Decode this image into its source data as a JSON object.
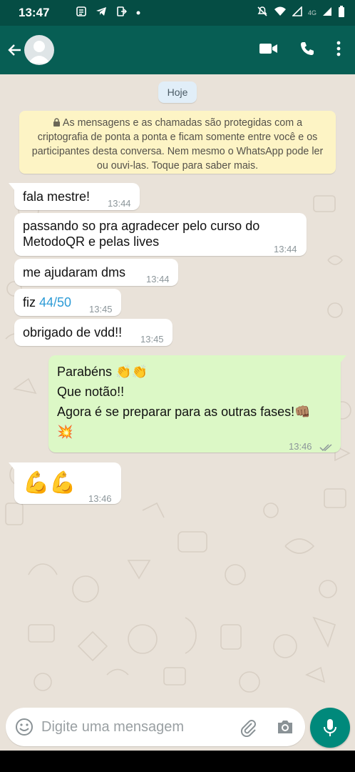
{
  "status_bar": {
    "time": "13:47",
    "network_label": "4G",
    "icons": [
      "gallery-icon",
      "telegram-icon",
      "exit-icon",
      "dot-icon",
      "mute-icon",
      "wifi-icon",
      "signal-icon",
      "signal-icon",
      "battery-icon"
    ]
  },
  "header": {
    "contact_name": "",
    "icons": [
      "back-arrow-icon",
      "avatar-icon",
      "video-call-icon",
      "phone-icon",
      "more-vert-icon"
    ]
  },
  "chat": {
    "date_chip": "Hoje",
    "encryption_notice": "As mensagens e as chamadas são protegidas com a criptografia de ponta a ponta e ficam somente entre você e os participantes desta conversa. Nem mesmo o WhatsApp pode ler ou ouvi-las. Toque para saber mais.",
    "messages": [
      {
        "direction": "in",
        "text": "fala mestre!",
        "time": "13:44"
      },
      {
        "direction": "in",
        "text_line1": "passando so pra agradecer pelo curso do",
        "text_line2": "MetodoQR e pelas lives",
        "time": "13:44"
      },
      {
        "direction": "in",
        "text": "me ajudaram dms",
        "time": "13:44"
      },
      {
        "direction": "in",
        "text_prefix": "fiz ",
        "text_link": "44/50",
        "time": "13:45"
      },
      {
        "direction": "in",
        "text": "obrigado de vdd!!",
        "time": "13:45"
      },
      {
        "direction": "out",
        "line1": "Parabéns 👏👏",
        "line2": "Que notão!!",
        "line3": "Agora é se preparar para as outras fases!👊🏽",
        "line4": "💥",
        "time": "13:46",
        "status": "read"
      },
      {
        "direction": "in",
        "text": "💪💪",
        "time": "13:46"
      }
    ]
  },
  "input_bar": {
    "placeholder": "Digite uma mensagem",
    "icons": [
      "emoji-icon",
      "attach-icon",
      "camera-icon",
      "mic-icon"
    ]
  },
  "colors": {
    "header": "#075e54",
    "status_bar": "#054d44",
    "chat_bg": "#e9e2d9",
    "outgoing_bubble": "#dcf8c6",
    "incoming_bubble": "#ffffff",
    "mic_button": "#00897b",
    "link": "#2d9bd6"
  }
}
